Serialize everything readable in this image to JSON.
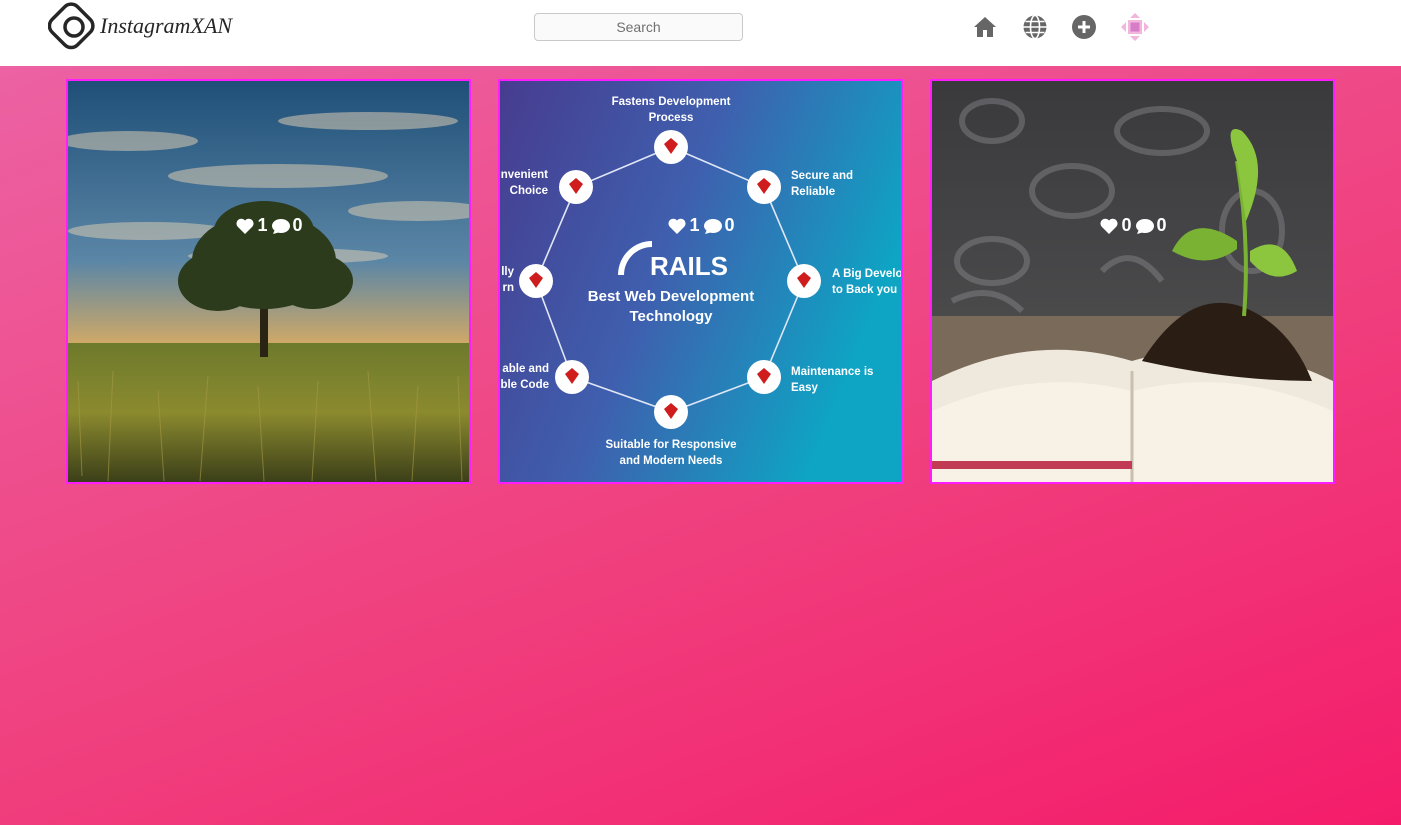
{
  "header": {
    "brand": "InstagramXAN",
    "search_placeholder": "Search",
    "icons": [
      "home-icon",
      "globe-icon",
      "add-post-icon",
      "profile-icon"
    ]
  },
  "colors": {
    "post_border": "#ff1dfd",
    "background_start": "#ec62a3",
    "background_end": "#f41c6a",
    "icon": "#666666"
  },
  "posts": [
    {
      "likes": "1",
      "comments": "0",
      "image": "tree-at-sunset"
    },
    {
      "likes": "1",
      "comments": "0",
      "image": "rails-infographic",
      "graphic": {
        "logo": "RAILS",
        "title_line1": "Best Web Development",
        "title_line2": "Technology",
        "points": [
          [
            "Fastens Development",
            "Process"
          ],
          [
            "Secure and",
            "Reliable"
          ],
          [
            "A Big Develop",
            "to Back you"
          ],
          [
            "Maintenance is",
            "Easy"
          ],
          [
            "Suitable for Responsive",
            "and Modern Needs"
          ],
          [
            "able and",
            "ble Code"
          ],
          [
            "lly",
            "rn"
          ],
          [
            "nvenient",
            "Choice"
          ]
        ]
      }
    },
    {
      "likes": "0",
      "comments": "0",
      "image": "sprout-on-book"
    }
  ]
}
